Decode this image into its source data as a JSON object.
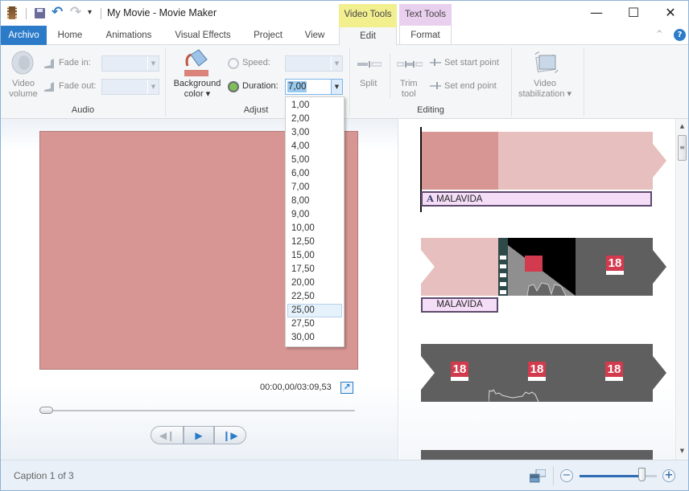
{
  "window": {
    "title": "My Movie - Movie Maker",
    "contextual_groups": {
      "video_tools": "Video Tools",
      "text_tools": "Text Tools"
    },
    "controls": {
      "minimize": "—",
      "maximize": "☐",
      "close": "✕"
    },
    "quick_access": {
      "undo": "↶",
      "redo": "↷",
      "customize": "▾"
    }
  },
  "tabs": [
    {
      "label": "Archivo"
    },
    {
      "label": "Home"
    },
    {
      "label": "Animations"
    },
    {
      "label": "Visual Effects"
    },
    {
      "label": "Project"
    },
    {
      "label": "View"
    },
    {
      "label": "Edit",
      "active": true
    },
    {
      "label": "Format"
    }
  ],
  "help": {
    "collapse": "^",
    "help": "?"
  },
  "ribbon": {
    "audio": {
      "group_label": "Audio",
      "video_volume": [
        "Video",
        "volume"
      ],
      "fade_in_label": "Fade in:",
      "fade_out_label": "Fade out:",
      "fade_in_value": "",
      "fade_out_value": ""
    },
    "adjust": {
      "group_label": "Adjust",
      "background_color": [
        "Background",
        "color ▾"
      ],
      "speed_label": "Speed:",
      "speed_value": "",
      "duration_label": "Duration:",
      "duration_value": "7,00"
    },
    "editing": {
      "group_label": "Editing",
      "split": "Split",
      "trim_tool": [
        "Trim",
        "tool"
      ],
      "set_start_point": "Set start point",
      "set_end_point": "Set end point"
    },
    "stabilization": {
      "label": [
        "Video",
        "stabilization ▾"
      ]
    }
  },
  "duration_dropdown": {
    "options": [
      "1,00",
      "2,00",
      "3,00",
      "4,00",
      "5,00",
      "6,00",
      "7,00",
      "8,00",
      "9,00",
      "10,00",
      "12,50",
      "15,00",
      "17,50",
      "20,00",
      "22,50",
      "25,00",
      "27,50",
      "30,00"
    ],
    "hovered": "25,00"
  },
  "preview": {
    "background_color": "#d79693",
    "timecode": "00:00,00/03:09,53",
    "seek_position": 0.0,
    "buttons": {
      "previous": "◀❙",
      "play": "▶",
      "next": "❙▶"
    }
  },
  "storyboard": {
    "clips": [
      {
        "type": "title",
        "caption": "MALAVIDA",
        "caption_icon": "A"
      },
      {
        "type": "video-transition",
        "caption": "MALAVIDA",
        "logo": "18"
      },
      {
        "type": "video",
        "logo": "18"
      }
    ],
    "scroll": {
      "up": "▲",
      "down": "▼",
      "grip": "≡"
    }
  },
  "status": {
    "text": "Caption 1 of 3",
    "zoom_level": 0.8,
    "zoom_out": "−",
    "zoom_in": "+"
  }
}
